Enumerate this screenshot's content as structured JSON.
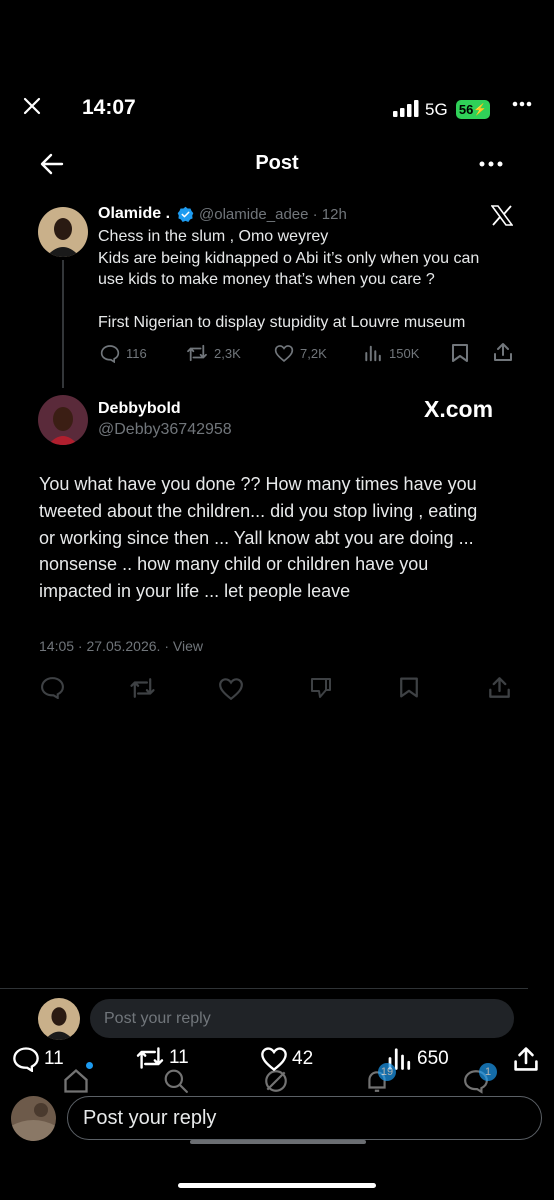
{
  "status_bar": {
    "time": "14:07",
    "network": "5G",
    "battery": "56"
  },
  "header": {
    "title": "Post"
  },
  "quoted_tweet": {
    "name": "Olamide .",
    "handle": "@olamide_adee · 12h",
    "lines": [
      "Chess in the slum , Omo weyrey",
      "Kids are being kidnapped o Abi it’s only when you can",
      "use kids to make money that’s when you care ?",
      "First Nigerian to display stupidity at Louvre museum"
    ],
    "actions": {
      "replies": "116",
      "reposts": "2,3K",
      "likes": "7,2K",
      "views": "150K"
    }
  },
  "reply_tweet": {
    "name": "Debbybold",
    "handle": "@Debby36742958",
    "watermark": "X.com",
    "lines": [
      "You what have you done ?? How many times have you",
      "tweeted about the children... did you stop living  , eating",
      "or working since then ... Yall know abt you are doing ...",
      "nonsense .. how many child  or children have you",
      "impacted in your life ... let people leave"
    ],
    "meta": "14:05 · 27.05.2026. · View"
  },
  "reply_box_top": {
    "placeholder": "Post your reply"
  },
  "bottom_stats": {
    "replies": "11",
    "reposts": "11",
    "likes": "42",
    "views": "650"
  },
  "bottom_nav": {
    "notifications_badge": "19",
    "messages_badge": "1"
  },
  "reply_box_bottom": {
    "placeholder": "Post your reply"
  }
}
